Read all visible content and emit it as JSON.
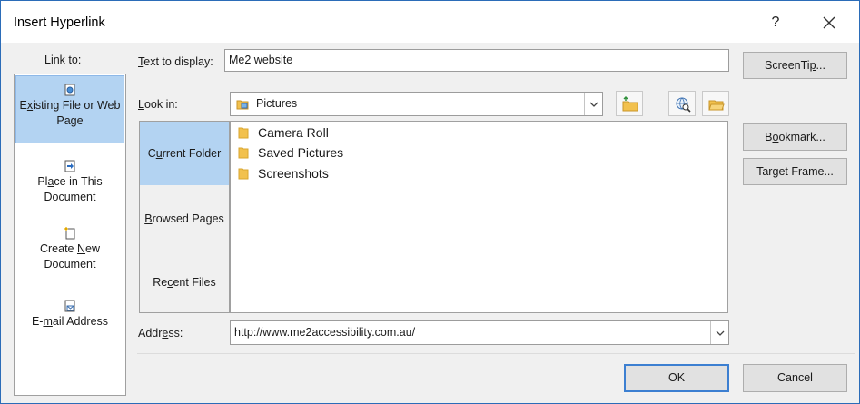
{
  "window": {
    "title": "Insert Hyperlink",
    "help_glyph": "?"
  },
  "link_to": {
    "label": "Link to:",
    "items": [
      {
        "before": "E",
        "key": "x",
        "after": "isting File or Web Page",
        "icon": "existing-file-icon",
        "selected": true
      },
      {
        "before": "Pl",
        "key": "a",
        "after": "ce in This Document",
        "icon": "place-in-document-icon",
        "selected": false
      },
      {
        "before": "Create ",
        "key": "N",
        "after": "ew Document",
        "icon": "new-document-icon",
        "selected": false
      },
      {
        "before": "E-",
        "key": "m",
        "after": "ail Address",
        "icon": "email-address-icon",
        "selected": false
      }
    ]
  },
  "text_to_display": {
    "label_key": "T",
    "label_rest": "ext to display:",
    "value": "Me2 website"
  },
  "screentip_button": {
    "before": "ScreenTi",
    "key": "p",
    "after": "..."
  },
  "look_in": {
    "label_key": "L",
    "label_rest": "ook in:",
    "value": "Pictures"
  },
  "browse_sections": [
    {
      "before": "C",
      "key": "u",
      "after": "rrent Folder",
      "selected": true
    },
    {
      "before": "",
      "key": "B",
      "after": "rowsed Pages",
      "selected": false
    },
    {
      "before": "Re",
      "key": "c",
      "after": "ent Files",
      "selected": false
    }
  ],
  "files": [
    "Camera Roll",
    "Saved Pictures",
    "Screenshots"
  ],
  "bookmark_button": {
    "before": "B",
    "key": "o",
    "after": "okmark..."
  },
  "target_frame_button": {
    "before": "Tar",
    "key": "g",
    "after": "et Frame..."
  },
  "address": {
    "label_before": "Addr",
    "label_key": "e",
    "label_after": "ss:",
    "value": "http://www.me2accessibility.com.au/"
  },
  "ok_label": "OK",
  "cancel_label": "Cancel",
  "colors": {
    "selected_bg": "#b3d3f2",
    "primary_border": "#3c7fd1",
    "folder_yellow": "#f2c14e"
  }
}
